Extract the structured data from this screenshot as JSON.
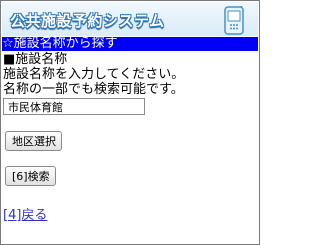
{
  "header": {
    "app_title": "公共施設予約システム",
    "logo_icon": "mobile-phone-icon"
  },
  "section": {
    "title": "☆施設名称から探す"
  },
  "form": {
    "field_heading": "■施設名称",
    "instruction_line1": "施設名称を入力してください。",
    "instruction_line2": "名称の一部でも検索可能です。",
    "facility_name_value": "市民体育館",
    "area_select_label": "地区選択",
    "search_label": "[6]検索"
  },
  "footer": {
    "back_link": "[4]戻る"
  },
  "colors": {
    "section_bar": "#0000f7",
    "header_gradient_top": "#f2f8fd",
    "header_gradient_bottom": "#d9ebf8",
    "title_outline": "#2f78b9",
    "link": "#3333cc"
  }
}
